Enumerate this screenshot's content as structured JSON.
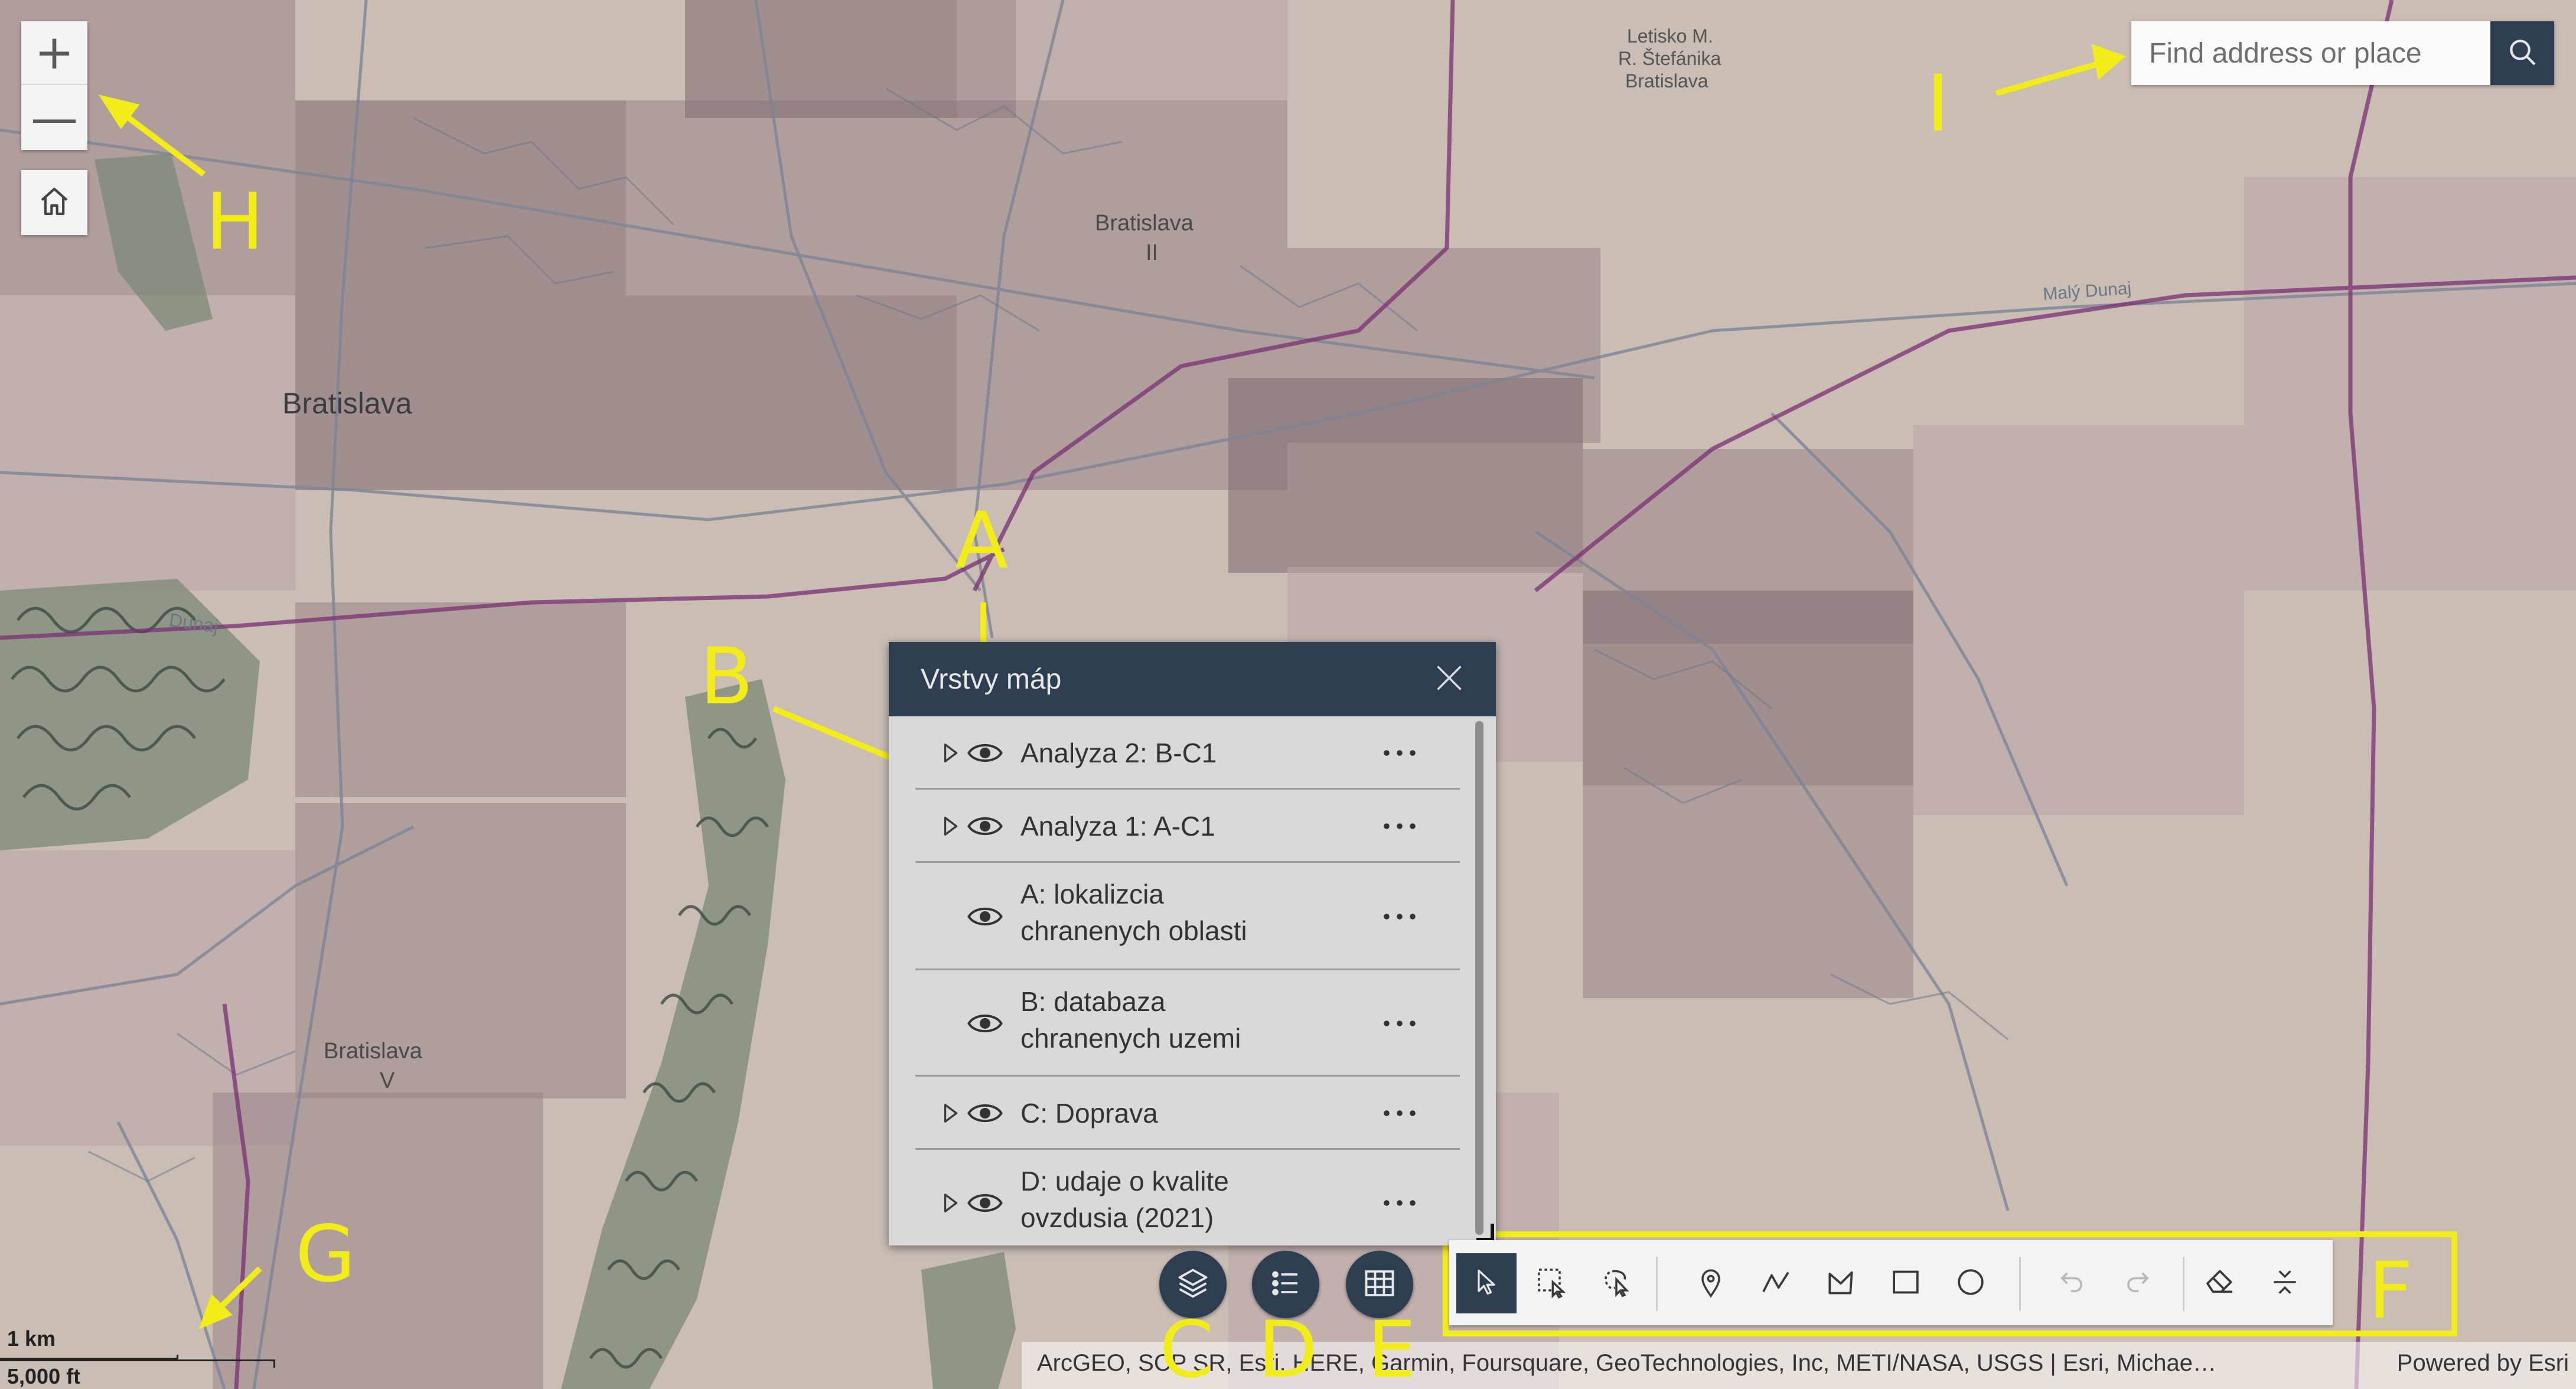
{
  "map": {
    "place_labels": {
      "bratislava": "Bratislava",
      "bratislava_ii": "Bratislava\nII",
      "bratislava_v": "Bratislava\nV",
      "airport": "Letisko M.\nR. Štefánika\nBratislava",
      "dunaj": "Dunaj",
      "maly_dunaj": "Malý Dunaj"
    },
    "colors": {
      "cell_dark": "#7e6a70",
      "cell_mid": "#9a858b",
      "cell_light": "#b9a6a8",
      "base": "#c9bdb4",
      "roads": "#7d8596",
      "highway": "#7a2f74",
      "forest": "#6d7a6a"
    }
  },
  "zoom": {
    "in_label": "+",
    "out_label": "—"
  },
  "home": {
    "icon": "home-icon"
  },
  "search": {
    "placeholder": "Find address or place",
    "icon": "search-icon"
  },
  "layer_panel": {
    "title": "Vrstvy máp",
    "close_icon": "close-icon",
    "layers": [
      {
        "name": "Analyza 2: B-C1",
        "expandable": true,
        "visible": true
      },
      {
        "name": "Analyza 1: A-C1",
        "expandable": true,
        "visible": true
      },
      {
        "name": "A: lokalizcia\nchranenych oblasti",
        "expandable": false,
        "visible": true
      },
      {
        "name": "B: databaza\nchranenych uzemi",
        "expandable": false,
        "visible": true
      },
      {
        "name": "C: Doprava",
        "expandable": true,
        "visible": true
      },
      {
        "name": "D: udaje o kvalite\novzdusia (2021)",
        "expandable": true,
        "visible": true
      }
    ]
  },
  "bottom_buttons": [
    "layers-icon",
    "legend-icon",
    "table-icon"
  ],
  "sketch_toolbar": {
    "tools": [
      "select-pointer-icon",
      "rectangle-select-icon",
      "lasso-select-icon",
      "point-icon",
      "polyline-icon",
      "polygon-icon",
      "rectangle-icon",
      "circle-icon",
      "undo-icon",
      "redo-icon",
      "eraser-icon",
      "collapse-icon"
    ],
    "active": "select-pointer-icon"
  },
  "attribution": {
    "text": "ArcGEO, SCP SR, Esri, HERE, Garmin, Foursquare, GeoTechnologies, Inc, METI/NASA, USGS | Esri, Michael Bauer Research",
    "powered": "Powered by Esri"
  },
  "scale": {
    "km": "1 km",
    "ft": "5,000 ft"
  },
  "annotations": {
    "A": "A",
    "B": "B",
    "C": "C",
    "D": "D",
    "E": "E",
    "F": "F",
    "G": "G",
    "H": "H",
    "I": "I",
    "color": "#f2ec18"
  }
}
